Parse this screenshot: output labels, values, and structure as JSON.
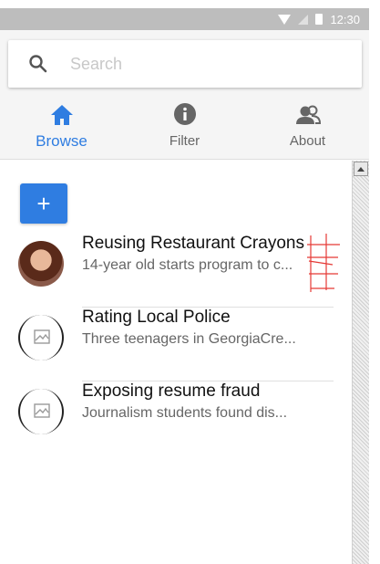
{
  "status_bar": {
    "time": "12:30"
  },
  "search": {
    "placeholder": "Search",
    "value": ""
  },
  "tabs": [
    {
      "label": "Browse",
      "icon": "home-icon",
      "active": true
    },
    {
      "label": "Filter",
      "icon": "info-icon",
      "active": false
    },
    {
      "label": "About",
      "icon": "people-icon",
      "active": false
    }
  ],
  "add_button": {
    "label": "+"
  },
  "items": [
    {
      "title": "Reusing Restaurant Crayons",
      "subtitle": "14-year old starts program to c...",
      "avatar": "photo"
    },
    {
      "title": "Rating Local Police",
      "subtitle": "Three teenagers in GeorgiaCre...",
      "avatar": "placeholder"
    },
    {
      "title": "Exposing resume fraud",
      "subtitle": "Journalism students found dis...",
      "avatar": "placeholder"
    }
  ],
  "colors": {
    "accent": "#2f7de1",
    "tab_icon": "#666666",
    "status_bar": "#bdbdbd"
  }
}
